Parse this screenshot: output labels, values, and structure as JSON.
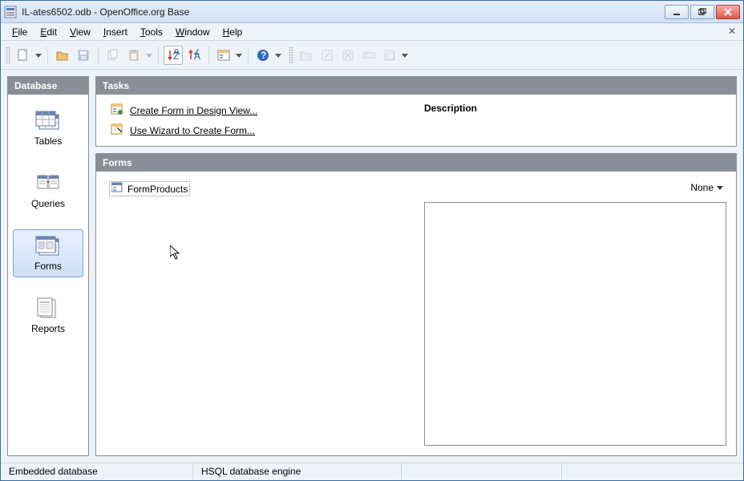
{
  "window": {
    "title": "IL-ates6502.odb - OpenOffice.org Base"
  },
  "menu": {
    "file": "File",
    "edit": "Edit",
    "view": "View",
    "insert": "Insert",
    "tools": "Tools",
    "window": "Window",
    "help": "Help"
  },
  "sidebar": {
    "heading": "Database",
    "tables": "Tables",
    "queries": "Queries",
    "forms": "Forms",
    "reports": "Reports",
    "selected": "forms"
  },
  "tasks": {
    "heading": "Tasks",
    "create_design": "Create Form in Design View...",
    "use_wizard": "Use Wizard to Create Form...",
    "description_label": "Description"
  },
  "forms_panel": {
    "heading": "Forms",
    "items": [
      "FormProducts"
    ],
    "preview_mode": "None"
  },
  "status": {
    "left": "Embedded database",
    "engine": "HSQL database engine"
  }
}
